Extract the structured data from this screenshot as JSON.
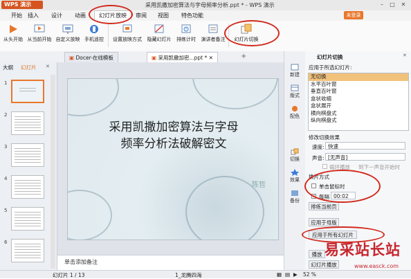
{
  "app": {
    "logo": "WPS 演示",
    "title": "采用凯撒加密算法与字母频率分析.ppt * - WPS 演示",
    "unlogin": "未登录"
  },
  "menu": {
    "items": [
      "开始",
      "插入",
      "设计",
      "动画",
      "幻灯片放映",
      "审阅",
      "视图",
      "特色功能"
    ],
    "active": "幻灯片放映"
  },
  "ribbon": {
    "buttons": [
      {
        "label": "从头开始",
        "icon": "play-start-icon"
      },
      {
        "label": "从当前开始",
        "icon": "play-current-icon"
      },
      {
        "label": "自定义放映",
        "icon": "custom-show-icon"
      },
      {
        "label": "手机遥控",
        "icon": "phone-remote-icon"
      },
      {
        "label": "设置放映方式",
        "icon": "setup-show-icon"
      },
      {
        "label": "隐藏幻灯片",
        "icon": "hide-slide-icon"
      },
      {
        "label": "排练计时",
        "icon": "rehearse-timing-icon"
      },
      {
        "label": "演讲者备注",
        "icon": "speaker-notes-icon"
      },
      {
        "label": "幻灯片切换",
        "icon": "slide-transition-icon"
      }
    ]
  },
  "tabs": {
    "doc1": "Docer-在线模板",
    "doc2": "采用凯撒加密...ppt *",
    "plus": "+"
  },
  "left_pane": {
    "tab_outline": "大纲",
    "tab_slides": "幻灯片",
    "thumbnails": [
      "1",
      "2",
      "3",
      "4",
      "5",
      "6",
      "7"
    ]
  },
  "slide": {
    "title_line1": "采用凯撒加密算法与字母",
    "title_line2": "频率分析法破解密文",
    "author": "陈哲"
  },
  "notes": {
    "placeholder": "单击添加备注"
  },
  "side_strip": {
    "items": [
      "新建",
      "版式",
      "配色",
      "切换",
      "效果",
      "备份"
    ]
  },
  "task_pane": {
    "title": "幻灯片切换",
    "apply_selected_label": "应用于所选幻灯片:",
    "effects": [
      "无切换",
      "水平百叶窗",
      "垂直百叶窗",
      "盒状收缩",
      "盒状展开",
      "横向棋盘式",
      "纵向棋盘式"
    ],
    "selected_effect": "无切换",
    "modify_label": "修改切换效果",
    "speed_label": "速度:",
    "speed_value": "快速",
    "sound_label": "声音:",
    "sound_value": "[无声音]",
    "loop_label": "循环播放",
    "loop_until_next": "到下一声音开始时",
    "advance_label": "换片方式",
    "on_click_label": "单击鼠标时",
    "on_click_checked": false,
    "interval_label": "每隔",
    "interval_checked": true,
    "interval_value": "00:02",
    "rehearse_button": "排练当前页",
    "apply_master_button": "应用于母版",
    "apply_all_button": "应用于所有幻灯片",
    "play_button": "播放",
    "slideshow_button": "幻灯片播放"
  },
  "status_bar": {
    "slide_count": "幻灯片 1 / 13",
    "theme": "1_龙腾四海",
    "zoom": "52 %"
  },
  "watermark": {
    "text": "易采站长站",
    "url": "www.easck.com"
  }
}
